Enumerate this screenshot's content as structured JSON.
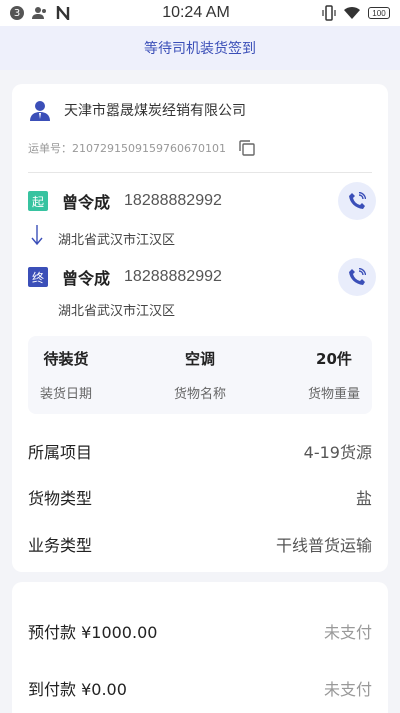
{
  "status_bar": {
    "notif_count": "3",
    "time": "10:24 AM",
    "battery": "100"
  },
  "banner": {
    "text": "等待司机装货签到"
  },
  "order": {
    "company": "天津市嚣晟煤炭经销有限公司",
    "waybill_label": "运单号：",
    "waybill_no": "2107291509159760670101"
  },
  "origin": {
    "tag": "起",
    "name": "曾令成",
    "phone": "18288882992",
    "address": "湖北省武汉市江汉区"
  },
  "destination": {
    "tag": "终",
    "name": "曾令成",
    "phone": "18288882992",
    "address": "湖北省武汉市江汉区"
  },
  "summary": [
    {
      "value": "待装货",
      "label": "装货日期"
    },
    {
      "value": "空调",
      "label": "货物名称"
    },
    {
      "value": "20件",
      "label": "货物重量"
    }
  ],
  "details": [
    {
      "label": "所属项目",
      "value": "4-19货源"
    },
    {
      "label": "货物类型",
      "value": "盐"
    },
    {
      "label": "业务类型",
      "value": "干线普货运输"
    }
  ],
  "payments": [
    {
      "label": "预付款 ¥1000.00",
      "status": "未支付"
    },
    {
      "label": "到付款 ¥0.00",
      "status": "未支付"
    }
  ],
  "colors": {
    "accent": "#3b4fb8",
    "start_tag": "#37c3a0",
    "banner_bg": "#eef0fb"
  }
}
